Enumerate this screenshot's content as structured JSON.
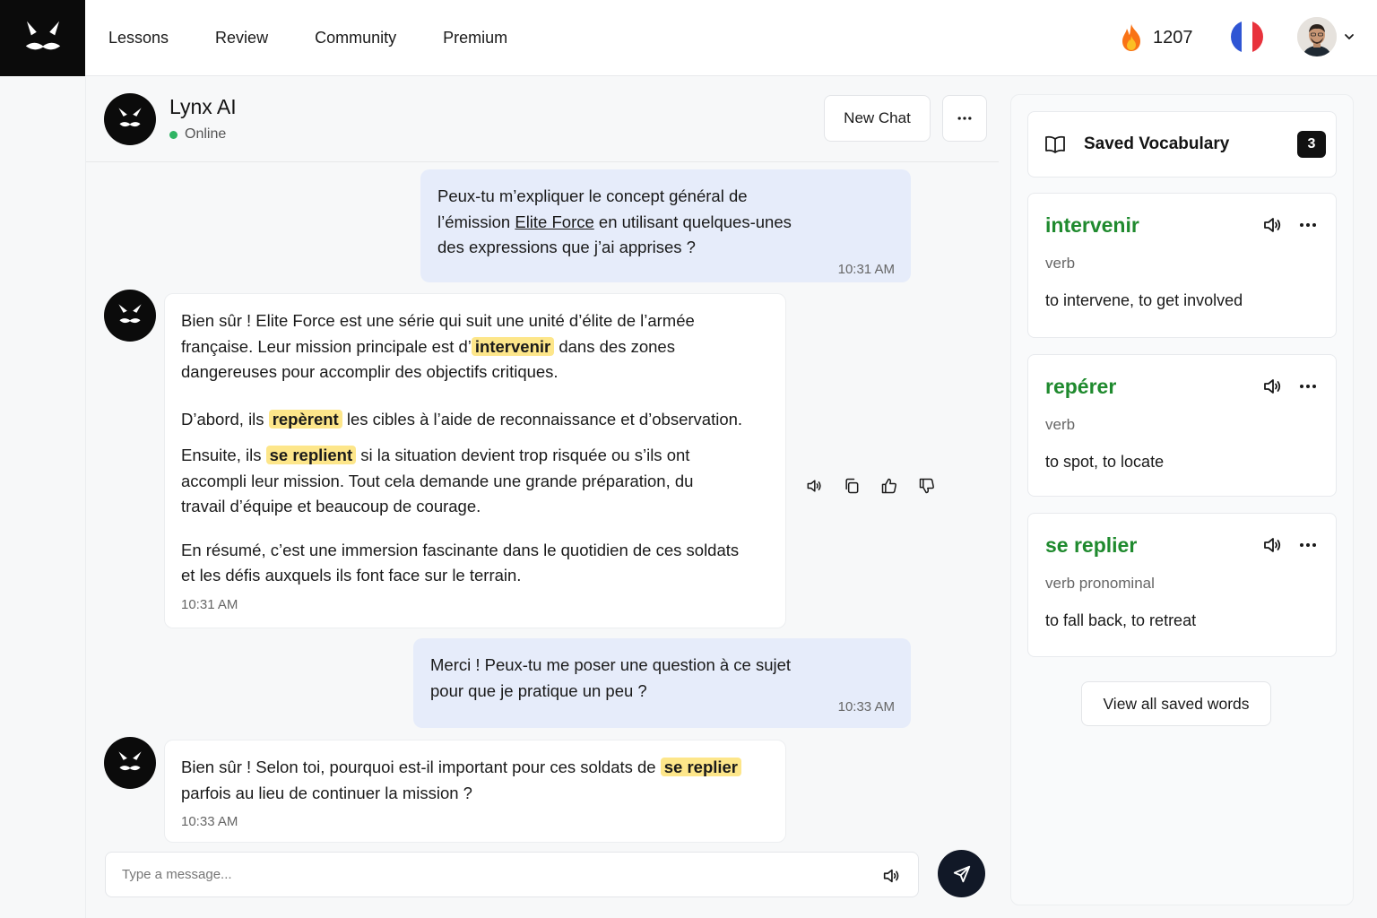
{
  "nav": {
    "items": [
      "Lessons",
      "Review",
      "Community",
      "Premium"
    ],
    "streak_count": "1207"
  },
  "chat": {
    "bot_name": "Lynx AI",
    "bot_status": "Online",
    "new_chat_label": "New Chat",
    "messages": [
      {
        "role": "user",
        "text_a": "Peux-tu m’expliquer le concept général de",
        "text_b": "l’émission ",
        "link": "Elite Force",
        "text_c": " en utilisant quelques-unes",
        "text_d": "des expressions que j’ai apprises ?",
        "time": "10:31 AM"
      },
      {
        "role": "bot",
        "p1a": "Bien sûr ! Elite Force est une série qui suit une unité d’élite de l’armée",
        "p1b": "française. Leur mission principale est d’",
        "p1hl": "intervenir",
        "p1c": " dans des zones",
        "p1d": "dangereuses pour accomplir des objectifs critiques.",
        "p2a": "D’abord, ils ",
        "p2hl": "repèrent",
        "p2b": " les cibles à l’aide de reconnaissance et d’observation.",
        "p3a": "Ensuite, ils ",
        "p3hl": "se replient",
        "p3b": " si la situation devient trop risquée ou s’ils ont",
        "p3c": "accompli leur mission. Tout cela demande une grande préparation, du",
        "p3d": "travail d’équipe et beaucoup de courage.",
        "p4a": "En résumé, c’est une immersion fascinante dans le quotidien de ces soldats",
        "p4b": "et les défis auxquels ils font face sur le terrain.",
        "time": "10:31 AM"
      },
      {
        "role": "user",
        "text_a": "Merci ! Peux-tu me poser une question à ce sujet",
        "text_b": "pour que je pratique un peu ?",
        "time": "10:33 AM"
      },
      {
        "role": "bot",
        "text_a": "Bien sûr ! Selon toi, pourquoi est-il important pour ces soldats de ",
        "hl": "se replier",
        "text_b": "parfois au lieu de continuer la mission ?",
        "time": "10:33 AM"
      }
    ],
    "input_placeholder": "Type a message..."
  },
  "vocab": {
    "title": "Saved Vocabulary",
    "count": "3",
    "cards": [
      {
        "word": "intervenir",
        "pos": "verb",
        "definition": "to intervene, to get involved"
      },
      {
        "word": "repérer",
        "pos": "verb",
        "definition": "to spot, to locate"
      },
      {
        "word": "se replier",
        "pos": "verb pronominal",
        "definition": "to fall back, to retreat"
      }
    ],
    "view_all_label": "View all saved words"
  },
  "icons": {
    "logo": "lynx-logo-icon",
    "streak": "flame-icon",
    "language": "french-flag-icon",
    "profile": "avatar",
    "menu": "chevron-down-icon",
    "message_actions": [
      "speaker-icon",
      "copy-icon",
      "thumbs-up-icon",
      "thumbs-down-icon"
    ],
    "send": "send-icon",
    "vocab": "book-icon"
  },
  "colors": {
    "accent_dark": "#111827",
    "vocab_word_green": "#1f8a2e",
    "highlight_yellow": "#fde68a",
    "user_bubble": "#e6ecfa",
    "online_green": "#2fb463",
    "flag_blue": "#2f55d4",
    "flag_red": "#e8323c"
  }
}
